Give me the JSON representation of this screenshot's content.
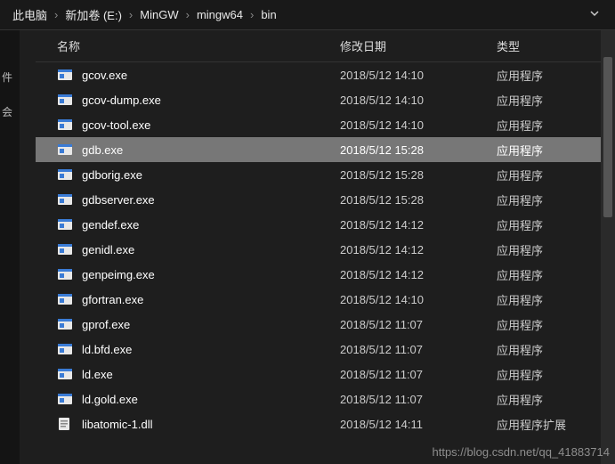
{
  "breadcrumb": {
    "items": [
      "此电脑",
      "新加卷 (E:)",
      "MinGW",
      "mingw64",
      "bin"
    ]
  },
  "columns": {
    "name": "名称",
    "date": "修改日期",
    "type": "类型"
  },
  "left_stub": {
    "a": "件",
    "b": "会"
  },
  "files": [
    {
      "icon": "exe",
      "name": "gcov.exe",
      "date": "2018/5/12 14:10",
      "type": "应用程序",
      "selected": false
    },
    {
      "icon": "exe",
      "name": "gcov-dump.exe",
      "date": "2018/5/12 14:10",
      "type": "应用程序",
      "selected": false
    },
    {
      "icon": "exe",
      "name": "gcov-tool.exe",
      "date": "2018/5/12 14:10",
      "type": "应用程序",
      "selected": false
    },
    {
      "icon": "exe",
      "name": "gdb.exe",
      "date": "2018/5/12 15:28",
      "type": "应用程序",
      "selected": true
    },
    {
      "icon": "exe",
      "name": "gdborig.exe",
      "date": "2018/5/12 15:28",
      "type": "应用程序",
      "selected": false
    },
    {
      "icon": "exe",
      "name": "gdbserver.exe",
      "date": "2018/5/12 15:28",
      "type": "应用程序",
      "selected": false
    },
    {
      "icon": "exe",
      "name": "gendef.exe",
      "date": "2018/5/12 14:12",
      "type": "应用程序",
      "selected": false
    },
    {
      "icon": "exe",
      "name": "genidl.exe",
      "date": "2018/5/12 14:12",
      "type": "应用程序",
      "selected": false
    },
    {
      "icon": "exe",
      "name": "genpeimg.exe",
      "date": "2018/5/12 14:12",
      "type": "应用程序",
      "selected": false
    },
    {
      "icon": "exe",
      "name": "gfortran.exe",
      "date": "2018/5/12 14:10",
      "type": "应用程序",
      "selected": false
    },
    {
      "icon": "exe",
      "name": "gprof.exe",
      "date": "2018/5/12 11:07",
      "type": "应用程序",
      "selected": false
    },
    {
      "icon": "exe",
      "name": "ld.bfd.exe",
      "date": "2018/5/12 11:07",
      "type": "应用程序",
      "selected": false
    },
    {
      "icon": "exe",
      "name": "ld.exe",
      "date": "2018/5/12 11:07",
      "type": "应用程序",
      "selected": false
    },
    {
      "icon": "exe",
      "name": "ld.gold.exe",
      "date": "2018/5/12 11:07",
      "type": "应用程序",
      "selected": false
    },
    {
      "icon": "dll",
      "name": "libatomic-1.dll",
      "date": "2018/5/12 14:11",
      "type": "应用程序扩展",
      "selected": false
    }
  ],
  "watermark": "https://blog.csdn.net/qq_41883714"
}
